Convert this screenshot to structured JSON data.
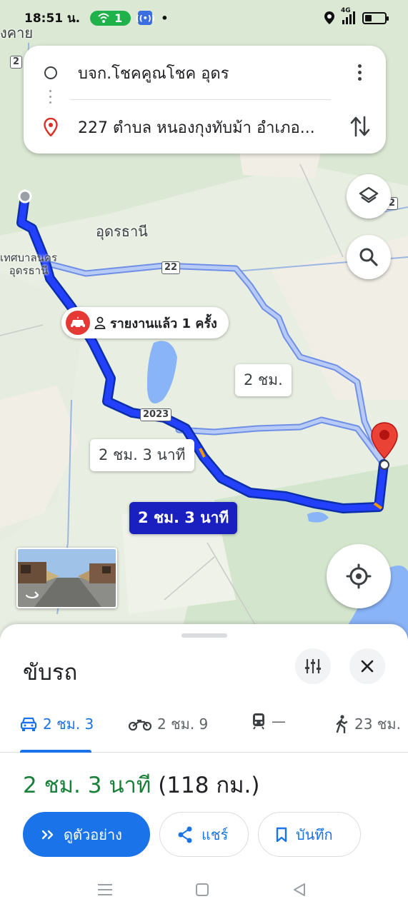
{
  "status_bar": {
    "time": "18:51 น.",
    "hotspot_count": "1",
    "network": "4G",
    "battery_level": 0.35
  },
  "route_search": {
    "origin": "บจก.โชคคูณโชค อุดร",
    "destination": "227 ตำบล หนองกุงทับม้า อำเภอ..."
  },
  "map": {
    "labels": {
      "nongkhai_partial": "งคาย",
      "udon": "อุดรธานี",
      "udon_city": "เทศบาลนคร\nอุดรธานี"
    },
    "shields": {
      "r2": "2",
      "r22": "22",
      "r2023": "2023",
      "r2_right": "2"
    },
    "report_chip": "รายงานแล้ว 1 ครั้ง",
    "callouts": {
      "alt_north": "2 ชม.",
      "alt_south": "2 ชม. 3 นาที",
      "selected": "2 ชม. 3 นาที"
    }
  },
  "sheet": {
    "title": "ขับรถ",
    "modes": [
      {
        "name": "car",
        "label": "2 ชม. 3"
      },
      {
        "name": "motorcycle",
        "label": "2 ชม. 9"
      },
      {
        "name": "transit",
        "label": "—"
      },
      {
        "name": "walk",
        "label": "23 ชม."
      }
    ],
    "duration": "2 ชม. 3 นาที",
    "distance": "(118 กม.)",
    "actions": {
      "preview": "ดูตัวอย่าง",
      "share": "แชร์",
      "save": "บันทึก"
    }
  },
  "colors": {
    "route_selected": "#1a1fc0",
    "route_alt": "#a9bff5",
    "accent": "#1a73e8",
    "duration_green": "#188038",
    "pin_red": "#ea4335"
  }
}
